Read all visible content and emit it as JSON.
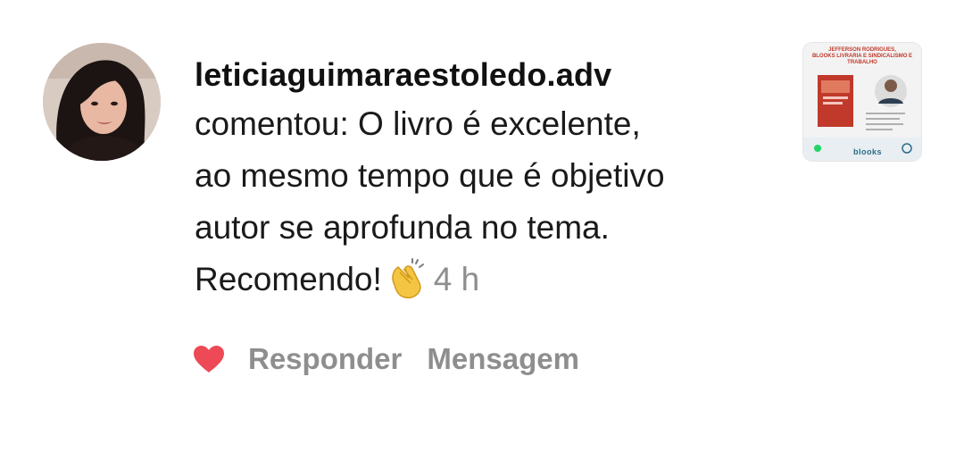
{
  "notification": {
    "username": "leticiaguimaraestoledo.adv",
    "comment_lines": [
      "comentou: O livro é excelente,",
      "ao mesmo tempo que é objetivo",
      "autor se aprofunda no tema.",
      "Recomendo!"
    ],
    "emoji": "clapping-hands-emoji",
    "time": "4 h",
    "liked": true
  },
  "actions": {
    "like_icon": "heart-icon",
    "like_color": "#ed4956",
    "reply_label": "Responder",
    "message_label": "Mensagem"
  },
  "post_thumbnail": {
    "header_line1": "JEFFERSON RODRIGUES,",
    "header_line2": "BLOOKS LIVRARIA E SINDICALISMO E TRABALHO",
    "footer_brand": "blooks"
  },
  "colors": {
    "text_primary": "#111111",
    "text_secondary": "#8e8e8e",
    "heart": "#ed4956"
  }
}
